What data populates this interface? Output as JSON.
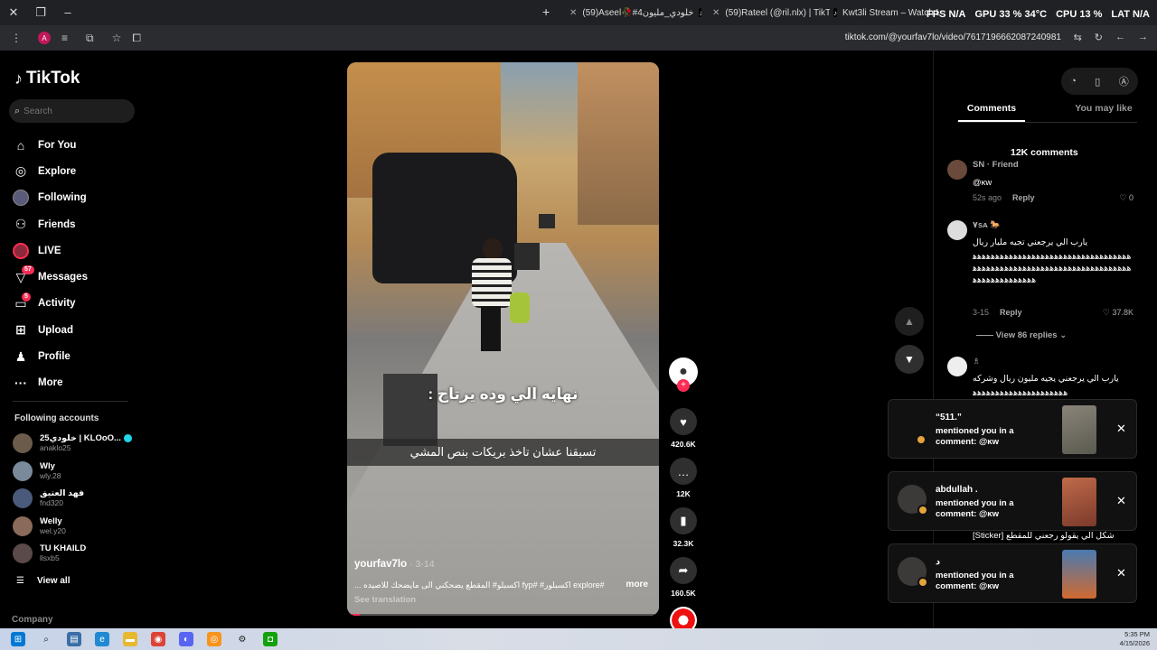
{
  "browser": {
    "tabs": [
      {
        "label": "(59)Aseel🥀#خلودي_مليون4"
      },
      {
        "label": "(59)Rateel (@ril.nlx) | TikTok"
      },
      {
        "label": "Kwt3li Stream – Watch Live o"
      }
    ],
    "stats": [
      "FPS N/A",
      "GPU 33 % 34°C",
      "CPU 13 %",
      "LAT N/A"
    ],
    "url": "tiktok.com/@yourfav7lo/video/7617196662087240981",
    "profile_letter": "A"
  },
  "sidebar": {
    "logo": "TikTok",
    "search_placeholder": "Search",
    "nav": [
      {
        "label": "For You",
        "icon": "home-icon"
      },
      {
        "label": "Explore",
        "icon": "compass-icon"
      },
      {
        "label": "Following",
        "icon": "following-avatar"
      },
      {
        "label": "Friends",
        "icon": "friends-icon"
      },
      {
        "label": "LIVE",
        "icon": "live-avatar"
      },
      {
        "label": "Messages",
        "icon": "messages-icon",
        "badge": "57"
      },
      {
        "label": "Activity",
        "icon": "activity-icon",
        "badge": "5"
      },
      {
        "label": "Upload",
        "icon": "upload-icon"
      },
      {
        "label": "Profile",
        "icon": "profile-icon"
      },
      {
        "label": "More",
        "icon": "more-icon"
      }
    ],
    "following_title": "Following accounts",
    "following": [
      {
        "name": "خلودي25 | KLOoO...",
        "handle": "anaklo25",
        "verified": true
      },
      {
        "name": "Wly",
        "handle": "wly.28"
      },
      {
        "name": "فهد العتيق",
        "handle": "fnd320"
      },
      {
        "name": "Welly",
        "handle": "wel.y20"
      },
      {
        "name": "TU KHAILD",
        "handle": "llsxb5"
      }
    ],
    "view_all": "View all",
    "company": "Company"
  },
  "video": {
    "caption_main": "نهايه الي وده يرتاح :",
    "caption_sub": "تسبقنا عشان تاخذ بريكات بنص المشي",
    "author": "yourfav7lo",
    "date": "3-14",
    "description": "#explore اكسبلور# #fyp اكسبلو# المقطع يضحكني الى مايضحك للاصيده ...",
    "more": "more",
    "see_translation": "See translation",
    "progress": 0.04
  },
  "actions": {
    "likes": "420.6K",
    "comments": "12K",
    "saves": "32.3K",
    "shares": "160.5K"
  },
  "panel": {
    "tabs": [
      "Comments",
      "You may like"
    ],
    "comment_count": "12K comments",
    "comments": [
      {
        "name": "SN · Friend",
        "text": "@ĸw",
        "time": "52s ago",
        "reply": "Reply",
        "likes": "0"
      },
      {
        "name": "٧sᴀ 🐎",
        "text": "يارب الي يرجعني تجيه مليار ريال",
        "text2": "ﻫﻫﻫﻫﻫﻫﻫﻫﻫﻫﻫﻫﻫﻫﻫﻫﻫﻫﻫﻫﻫﻫﻫﻫﻫﻫﻫﻫﻫﻫﻫﻫﻫﻫﻫﻫﻫﻫﻫﻫﻫﻫﻫﻫﻫﻫﻫﻫﻫﻫﻫﻫﻫﻫﻫﻫﻫﻫﻫﻫﻫﻫﻫﻫﻫﻫﻫﻫﻫﻫﻫﻫﻫﻫﻫﻫﻫﻫﻫﻫﻫﻫﻫﻫ",
        "time": "3-15",
        "reply": "Reply",
        "likes": "37.8K"
      },
      {
        "name": "♗",
        "text": "يارب الي يرجعني يجيه مليون ريال وشركه",
        "text2": "ﻫﻫﻫﻫﻫﻫﻫﻫﻫﻫﻫﻫﻫﻫﻫﻫﻫﻫﻫﻫﻫ"
      }
    ],
    "view_replies": "View 86 replies"
  },
  "notifications": [
    {
      "title": "“511.”",
      "body": "mentioned you in a comment: @ĸw"
    },
    {
      "title": "abdullah .",
      "body": "mentioned you in a comment: @ĸw"
    },
    {
      "title": "د",
      "body": "mentioned you in a comment: @ĸw"
    }
  ],
  "partial_comment": "[Sticker] شكل الي يقولو رجعني للمقطع",
  "taskbar": {
    "time": "5:35 PM",
    "date": "4/15/2026"
  }
}
